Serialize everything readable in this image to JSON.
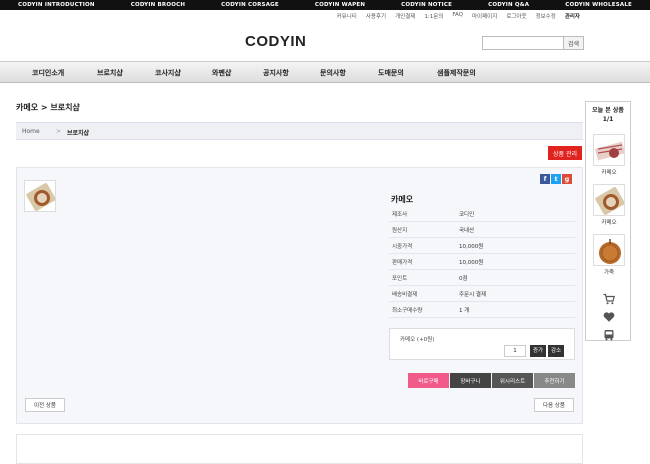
{
  "top_bar": {
    "links": [
      "CODYIN INTRODUCTION",
      "CODYIN BROOCH",
      "CODYIN CORSAGE",
      "CODYIN WAPEN",
      "CODYIN NOTICE",
      "CODYIN Q&A",
      "CODYIN WHOLESALE"
    ]
  },
  "util_nav": [
    "커뮤니티",
    "사용후기",
    "개인결제",
    "1:1문의",
    "FAQ",
    "마이페이지",
    "로그아웃",
    "정보수정",
    "관리자"
  ],
  "logo": "CODYIN",
  "search": {
    "button": "검색",
    "placeholder": ""
  },
  "main_nav": [
    "코디인소개",
    "브로치샵",
    "코사지샵",
    "와펜샵",
    "공지사항",
    "문의사항",
    "도매문의",
    "샘플제작문의"
  ],
  "breadcrumb": {
    "title": "카메오 > 브로치샵",
    "home": "Home",
    "separator": ">",
    "current": "브로치샵"
  },
  "manage_button": "상품 관리",
  "product": {
    "name": "카메오",
    "info": [
      {
        "label": "제조사",
        "value": "코디인"
      },
      {
        "label": "원산지",
        "value": "국내산"
      },
      {
        "label": "시중가격",
        "value": "10,000원"
      },
      {
        "label": "판매가격",
        "value": "10,000원"
      },
      {
        "label": "포인트",
        "value": "0점"
      },
      {
        "label": "배송비결제",
        "value": "주문시 결제"
      },
      {
        "label": "최소구매수량",
        "value": "1 개"
      }
    ],
    "option": {
      "name": "카메오 (+0원)",
      "quantity": "1",
      "increase": "증가",
      "decrease": "감소"
    },
    "actions": [
      {
        "label": "바로구매",
        "color": "#f25a8a"
      },
      {
        "label": "장바구니",
        "color": "#444444"
      },
      {
        "label": "위시리스트",
        "color": "#555555"
      },
      {
        "label": "추천하기",
        "color": "#888888"
      }
    ],
    "prev": "이전 상품",
    "next": "다음 상품"
  },
  "share_icons": [
    {
      "name": "facebook-icon",
      "glyph": "f",
      "color": "#3b5998"
    },
    {
      "name": "twitter-icon",
      "glyph": "t",
      "color": "#1da1f2"
    },
    {
      "name": "google-plus-icon",
      "glyph": "g",
      "color": "#dd4b39"
    }
  ],
  "recent": {
    "title": "오늘 본 상품",
    "count": "1/1",
    "items": [
      {
        "label": "카메오",
        "image": "brooch-strap-image"
      },
      {
        "label": "카메오",
        "image": "brooch-medallion-image"
      },
      {
        "label": "가죽",
        "image": "brooch-leather-image"
      }
    ],
    "icons": [
      "cart-icon",
      "heart-icon",
      "bus-icon"
    ]
  }
}
